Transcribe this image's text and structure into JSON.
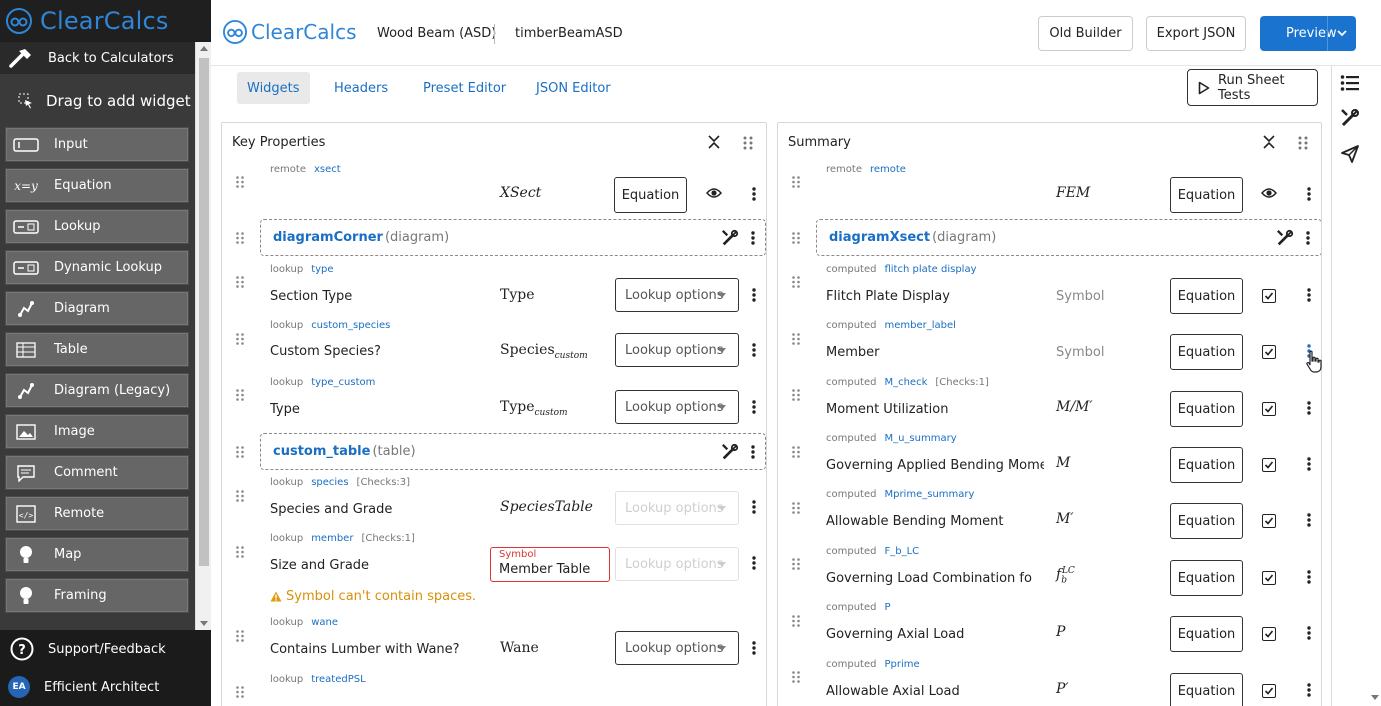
{
  "sidebar": {
    "logo_text": "ClearCalcs",
    "back_label": "Back to Calculators",
    "drag_label": "Drag to add widget",
    "items": [
      {
        "label": "Input",
        "icon": "input-icon"
      },
      {
        "label": "Equation",
        "icon": "equation-icon"
      },
      {
        "label": "Lookup",
        "icon": "lookup-icon"
      },
      {
        "label": "Dynamic Lookup",
        "icon": "dynamic-lookup-icon"
      },
      {
        "label": "Diagram",
        "icon": "diagram-icon"
      },
      {
        "label": "Table",
        "icon": "table-icon"
      },
      {
        "label": "Diagram (Legacy)",
        "icon": "diagram-legacy-icon"
      },
      {
        "label": "Image",
        "icon": "image-icon"
      },
      {
        "label": "Comment",
        "icon": "comment-icon"
      },
      {
        "label": "Remote",
        "icon": "remote-icon"
      },
      {
        "label": "Map",
        "icon": "map-icon"
      },
      {
        "label": "Framing",
        "icon": "framing-icon"
      }
    ],
    "support_label": "Support/Feedback",
    "user_initials": "EA",
    "user_name": "Efficient Architect"
  },
  "header": {
    "logo_text": "ClearCalcs",
    "sheet_name": "Wood Beam (ASD)",
    "sheet_id": "timberBeamASD",
    "old_builder_label": "Old Builder",
    "export_label": "Export JSON",
    "preview_label": "Preview"
  },
  "tabs": {
    "items": [
      "Widgets",
      "Headers",
      "Preset Editor",
      "JSON Editor"
    ],
    "active": "Widgets",
    "run_tests_label": "Run Sheet Tests"
  },
  "panels": {
    "key": {
      "title": "Key Properties",
      "rows": [
        {
          "kind": "remote",
          "ref": "xsect",
          "symbol": "XSect",
          "button": "Equation",
          "visible": true
        },
        {
          "kind": "group",
          "name": "diagramCorner",
          "type": "(diagram)"
        },
        {
          "kind": "lookup",
          "ref": "type",
          "label": "Section Type",
          "symbol": "Type",
          "button": "Lookup options"
        },
        {
          "kind": "lookup",
          "ref": "custom_species",
          "label": "Custom Species?",
          "symbol": "Species",
          "symbol_sub": "custom",
          "button": "Lookup options"
        },
        {
          "kind": "lookup",
          "ref": "type_custom",
          "label": "Type",
          "symbol": "Type",
          "symbol_sub": "custom",
          "button": "Lookup options"
        },
        {
          "kind": "group",
          "name": "custom_table",
          "type": "(table)"
        },
        {
          "kind": "lookup",
          "ref": "species",
          "checks": "[Checks:3]",
          "label": "Species and Grade",
          "symbol": "SpeciesTable",
          "button": "Lookup options",
          "disabled": true
        },
        {
          "kind": "lookup",
          "ref": "member",
          "checks": "[Checks:1]",
          "label": "Size and Grade",
          "symbol_input_label": "Symbol",
          "symbol_input_value": "Member Table",
          "button": "Lookup options",
          "disabled": true,
          "warning": "Symbol can't contain spaces."
        },
        {
          "kind": "lookup",
          "ref": "wane",
          "label": "Contains Lumber with Wane?",
          "symbol": "Wane",
          "button": "Lookup options"
        },
        {
          "kind": "lookup",
          "ref": "treatedPSL"
        }
      ]
    },
    "summary": {
      "title": "Summary",
      "rows": [
        {
          "kind": "remote",
          "ref": "remote",
          "symbol": "FEM",
          "button": "Equation",
          "visible": true
        },
        {
          "kind": "group",
          "name": "diagramXsect",
          "type": "(diagram)"
        },
        {
          "kind": "computed",
          "ref": "flitch plate display",
          "label": "Flitch Plate Display",
          "symbol_plain": "Symbol",
          "button": "Equation",
          "checked": true
        },
        {
          "kind": "computed",
          "ref": "member_label",
          "label": "Member",
          "symbol_plain": "Symbol",
          "button": "Equation",
          "checked": true
        },
        {
          "kind": "computed",
          "ref": "M_check",
          "checks": "[Checks:1]",
          "label": "Moment Utilization",
          "symbol": "M/M′",
          "button": "Equation",
          "checked": true
        },
        {
          "kind": "computed",
          "ref": "M_u_summary",
          "label": "Governing Applied Bending Moment",
          "symbol": "M",
          "button": "Equation",
          "checked": true
        },
        {
          "kind": "computed",
          "ref": "Mprime_summary",
          "label": "Allowable Bending Moment",
          "symbol": "M′",
          "button": "Equation",
          "checked": true
        },
        {
          "kind": "computed",
          "ref": "F_b_LC",
          "label": "Governing Load Combination for Ber",
          "symbol": "f",
          "symbol_sub": "b",
          "symbol_sup": "LC",
          "button": "Equation",
          "checked": true
        },
        {
          "kind": "computed",
          "ref": "P",
          "label": "Governing Axial Load",
          "symbol": "P",
          "button": "Equation",
          "checked": true
        },
        {
          "kind": "computed",
          "ref": "Pprime",
          "label": "Allowable Axial Load",
          "symbol": "P′",
          "button": "Equation",
          "checked": true
        }
      ]
    }
  },
  "colors": {
    "brand": "#2f86d6",
    "primary": "#1a74cf",
    "link": "#1a6fc4",
    "warning": "#d8900a",
    "error": "#dd3333"
  }
}
